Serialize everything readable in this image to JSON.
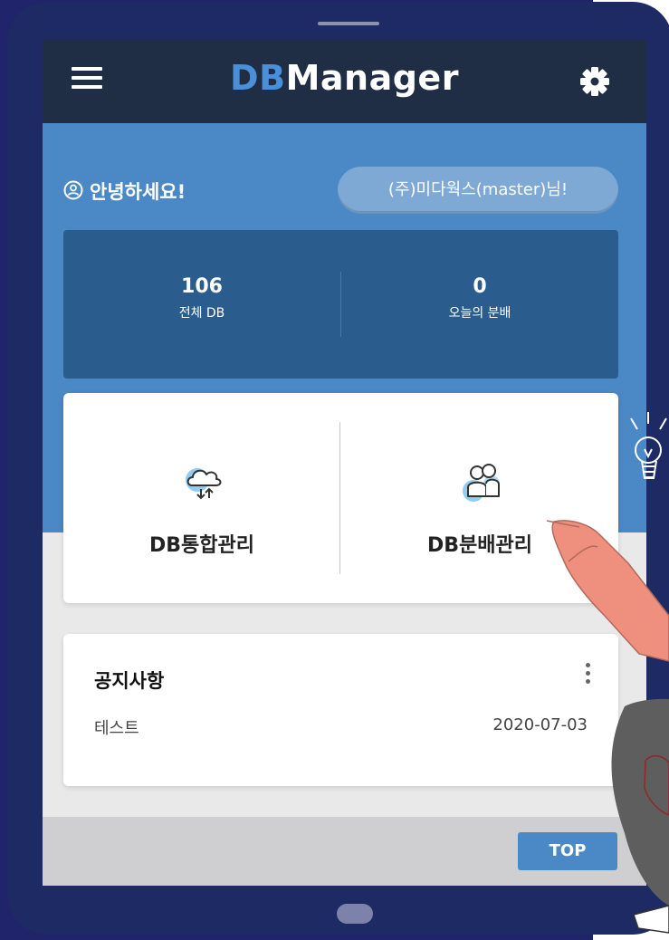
{
  "colors": {
    "header_bg": "#1f2e45",
    "accent": "#4b88c6",
    "stats_bg": "#2a5c8e",
    "logo_db": "#4a90d9"
  },
  "header": {
    "title_prefix": "DB",
    "title_suffix": "Manager",
    "menu_icon": "hamburger-icon",
    "settings_icon": "gear-icon"
  },
  "greeting": {
    "icon": "user-circle-icon",
    "text": "안녕하세요!",
    "user": "(주)미다웍스(master)님!"
  },
  "stats": [
    {
      "value": "106",
      "label": "전체 DB"
    },
    {
      "value": "0",
      "label": "오늘의 분배"
    }
  ],
  "menu": [
    {
      "label": "DB통합관리",
      "icon": "cloud-sync-icon"
    },
    {
      "label": "DB분배관리",
      "icon": "users-icon"
    }
  ],
  "notice": {
    "title": "공지사항",
    "more_icon": "kebab-menu-icon",
    "items": [
      {
        "text": "테스트",
        "date": "2020-07-03"
      }
    ]
  },
  "footer": {
    "top_label": "TOP"
  }
}
